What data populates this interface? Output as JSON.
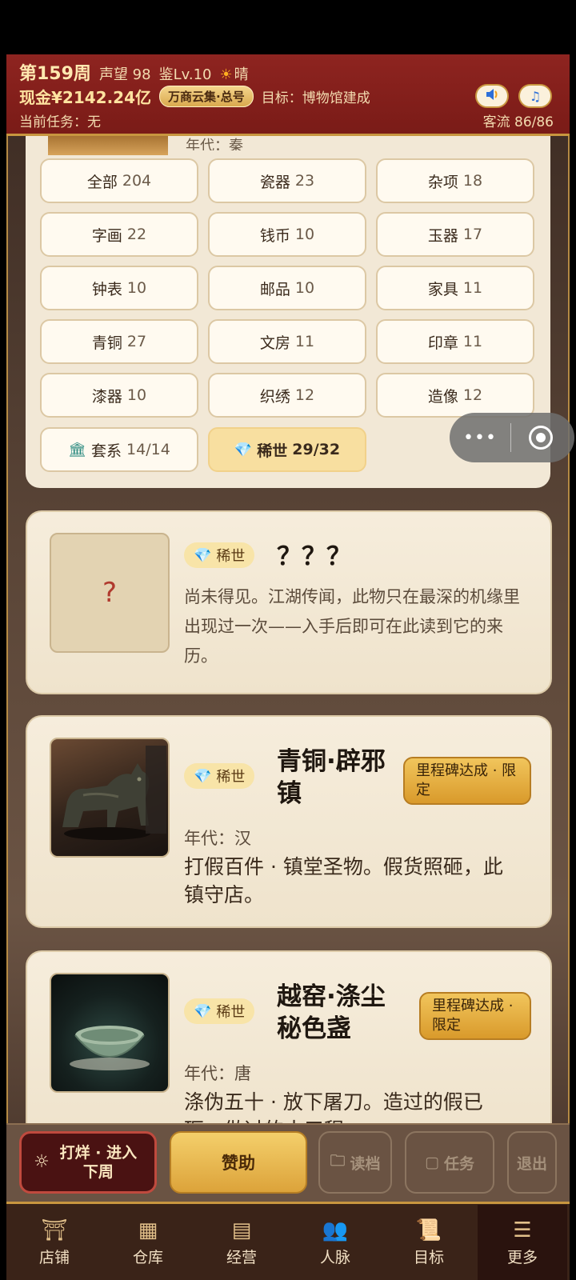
{
  "header": {
    "week": "第159周",
    "reputation": "声望 98",
    "appraise": "鉴Lv.10",
    "weather_icon": "sun-icon",
    "weather": "晴",
    "cash": "现金¥2142.24亿",
    "guild": "万商云集·总号",
    "goal": "目标：博物馆建成",
    "task": "当前任务：无",
    "traffic": "客流 86/86",
    "sound_icon": "speaker-icon",
    "music_icon": "music-note-icon"
  },
  "peek": {
    "era": "年代：秦"
  },
  "filters": [
    {
      "label": "全部",
      "count": "204"
    },
    {
      "label": "瓷器",
      "count": "23"
    },
    {
      "label": "杂项",
      "count": "18"
    },
    {
      "label": "字画",
      "count": "22"
    },
    {
      "label": "钱币",
      "count": "10"
    },
    {
      "label": "玉器",
      "count": "17"
    },
    {
      "label": "钟表",
      "count": "10"
    },
    {
      "label": "邮品",
      "count": "10"
    },
    {
      "label": "家具",
      "count": "11"
    },
    {
      "label": "青铜",
      "count": "27"
    },
    {
      "label": "文房",
      "count": "11"
    },
    {
      "label": "印章",
      "count": "11"
    },
    {
      "label": "漆器",
      "count": "10"
    },
    {
      "label": "织绣",
      "count": "12"
    },
    {
      "label": "造像",
      "count": "12"
    }
  ],
  "special_filters": {
    "sets": {
      "label": "套系",
      "count": "14/14"
    },
    "rare": {
      "label": "稀世",
      "count": "29/32"
    }
  },
  "capsule": {
    "more": "•••"
  },
  "cards": [
    {
      "tag": "稀世",
      "title": "？？？",
      "thumb": "?",
      "desc": "尚未得见。江湖传闻，此物只在最深的机缘里出现过一次——入手后即可在此读到它的来历。"
    },
    {
      "tag": "稀世",
      "title": "青铜·辟邪镇",
      "badge": "里程碑达成 · 限定",
      "era": "年代：汉",
      "desc": "打假百件 · 镇堂圣物。假货照砸，此镇守店。"
    },
    {
      "tag": "稀世",
      "title": "越窑·涤尘秘色盏",
      "badge": "里程碑达成 · 限定",
      "era": "年代：唐",
      "desc": "涤伪五十 · 放下屠刀。造过的假已砸，做过的十三程"
    }
  ],
  "actions": {
    "next_week": "打烊 · 进入下周",
    "sponsor": "赞助",
    "load": "读档",
    "tasks": "任务",
    "exit": "退出"
  },
  "tabs": [
    {
      "label": "店铺",
      "icon": "shop-icon"
    },
    {
      "label": "仓库",
      "icon": "warehouse-icon"
    },
    {
      "label": "经营",
      "icon": "abacus-icon"
    },
    {
      "label": "人脉",
      "icon": "people-icon"
    },
    {
      "label": "目标",
      "icon": "scroll-icon"
    },
    {
      "label": "更多",
      "icon": "more-icon"
    }
  ],
  "colors": {
    "header": "#8e2420",
    "accent_gold": "#d9a94e",
    "rare_tag": "#f8e4a8",
    "panel": "#f2e8d6"
  }
}
